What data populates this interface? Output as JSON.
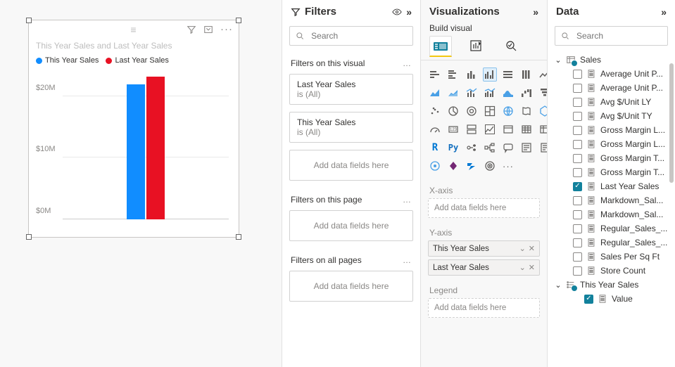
{
  "chart_data": {
    "type": "bar",
    "title": "This Year Sales and Last Year Sales",
    "categories": [
      ""
    ],
    "series": [
      {
        "name": "This Year Sales",
        "color": "#118dff",
        "values": [
          22000000
        ]
      },
      {
        "name": "Last Year Sales",
        "color": "#e81123",
        "values": [
          23200000
        ]
      }
    ],
    "ylabel": "",
    "ylim": [
      0,
      24000000
    ],
    "y_ticks": [
      0,
      10000000,
      20000000
    ],
    "y_tick_labels": [
      "$0M",
      "$10M",
      "$20M"
    ]
  },
  "canvas": {
    "legend": [
      "This Year Sales",
      "Last Year Sales"
    ]
  },
  "filters": {
    "title": "Filters",
    "search_placeholder": "Search",
    "on_visual_title": "Filters on this visual",
    "on_page_title": "Filters on this page",
    "on_all_title": "Filters on all pages",
    "add_label": "Add data fields here",
    "visual_filters": [
      {
        "name": "Last Year Sales",
        "summary": "is (All)"
      },
      {
        "name": "This Year Sales",
        "summary": "is (All)"
      }
    ]
  },
  "viz": {
    "title": "Visualizations",
    "subtitle": "Build visual",
    "xaxis_title": "X-axis",
    "yaxis_title": "Y-axis",
    "legend_title": "Legend",
    "drop_label": "Add data fields here",
    "yaxis_fields": [
      "This Year Sales",
      "Last Year Sales"
    ]
  },
  "data": {
    "title": "Data",
    "search_placeholder": "Search",
    "table1": "Sales",
    "table1_fields": [
      {
        "label": "Average Unit P...",
        "checked": false,
        "icon": "calc"
      },
      {
        "label": "Average Unit P...",
        "checked": false,
        "icon": "calc"
      },
      {
        "label": "Avg $/Unit LY",
        "checked": false,
        "icon": "calc"
      },
      {
        "label": "Avg $/Unit TY",
        "checked": false,
        "icon": "calc"
      },
      {
        "label": "Gross Margin L...",
        "checked": false,
        "icon": "calc"
      },
      {
        "label": "Gross Margin L...",
        "checked": false,
        "icon": "calc"
      },
      {
        "label": "Gross Margin T...",
        "checked": false,
        "icon": "calc"
      },
      {
        "label": "Gross Margin T...",
        "checked": false,
        "icon": "calc"
      },
      {
        "label": "Last Year Sales",
        "checked": true,
        "icon": "calc"
      },
      {
        "label": "Markdown_Sal...",
        "checked": false,
        "icon": "calc"
      },
      {
        "label": "Markdown_Sal...",
        "checked": false,
        "icon": "calc"
      },
      {
        "label": "Regular_Sales_...",
        "checked": false,
        "icon": "calc"
      },
      {
        "label": "Regular_Sales_...",
        "checked": false,
        "icon": "calc"
      },
      {
        "label": "Sales Per Sq Ft",
        "checked": false,
        "icon": "calc"
      },
      {
        "label": "Store Count",
        "checked": false,
        "icon": "calc"
      }
    ],
    "table2": "This Year Sales",
    "table2_fields": [
      {
        "label": "Value",
        "checked": true,
        "icon": "calc"
      }
    ]
  }
}
